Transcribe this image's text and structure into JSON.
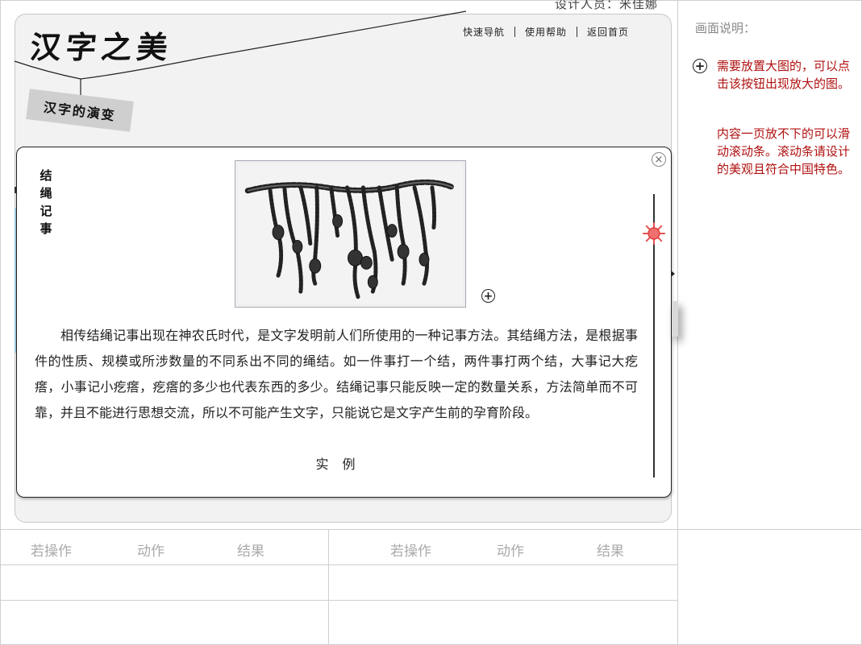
{
  "designer_label": "设计人员：米佳娜",
  "app_title": "汉字之美",
  "top_nav": {
    "quick_nav": "快速导航",
    "help": "使用帮助",
    "home": "返回首页"
  },
  "subtitle": "汉字的演变",
  "popup": {
    "heading": "结绳记事",
    "close_symbol": "×",
    "zoom_symbol": "+",
    "body": "相传结绳记事出现在神农氏时代，是文字发明前人们所使用的一种记事方法。其结绳方法，是根据事件的性质、规模或所涉数量的不同系出不同的绳结。如一件事打一个结，两件事打两个结，大事记大疙瘩，小事记小疙瘩，疙瘩的多少也代表东西的多少。结绳记事只能反映一定的数量关系，方法简单而不可靠，并且不能进行思想交流，所以不可能产生文字，只能说它是文字产生前的孕育阶段。",
    "example_link": "实 例"
  },
  "annotations": {
    "title": "画面说明：",
    "icon_symbol": "+",
    "note_zoom": "需要放置大图的，可以点击该按钮出现放大的图。",
    "note_scroll": "内容一页放不下的可以滑动滚动条。滚动条请设计的美观且符合中国特色。"
  },
  "table": {
    "left_headers": [
      "若操作",
      "动作",
      "结果"
    ],
    "right_headers": [
      "若操作",
      "动作",
      "结果"
    ]
  },
  "colors": {
    "annotation_red": "#b01010",
    "scroll_thumb": "#e85050",
    "panel_bg": "#f2f2f2"
  },
  "icons": {
    "close": "close-icon",
    "zoom": "zoom-in-icon",
    "scroll_thumb": "sun-icon"
  }
}
